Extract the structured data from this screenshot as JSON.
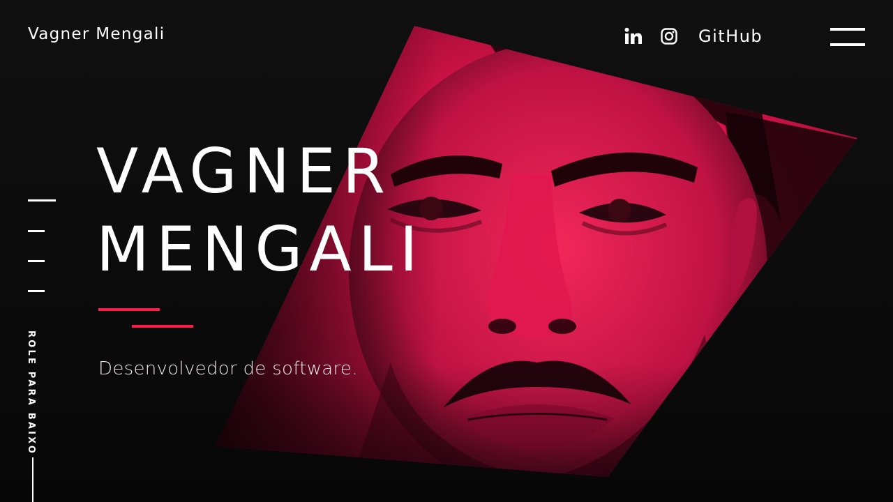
{
  "header": {
    "brand": "Vagner Mengali",
    "social": {
      "linkedin_icon": "linkedin-icon",
      "instagram_icon": "instagram-icon",
      "github_label": "GitHub"
    },
    "menu_icon": "hamburger-menu-icon"
  },
  "hero": {
    "title_line_1": "VAGNER",
    "title_line_2": "MENGALI",
    "subtitle": "Desenvolvedor de software.",
    "portrait_icon": "portrait-illustration"
  },
  "side": {
    "scroll_hint": "ROLE PARA BAIXO",
    "nav_marks_count": 4
  },
  "colors": {
    "background": "#0b0b0c",
    "accent": "#ff1a4b",
    "portrait_tint": "#e0144a",
    "text": "#ffffff"
  }
}
